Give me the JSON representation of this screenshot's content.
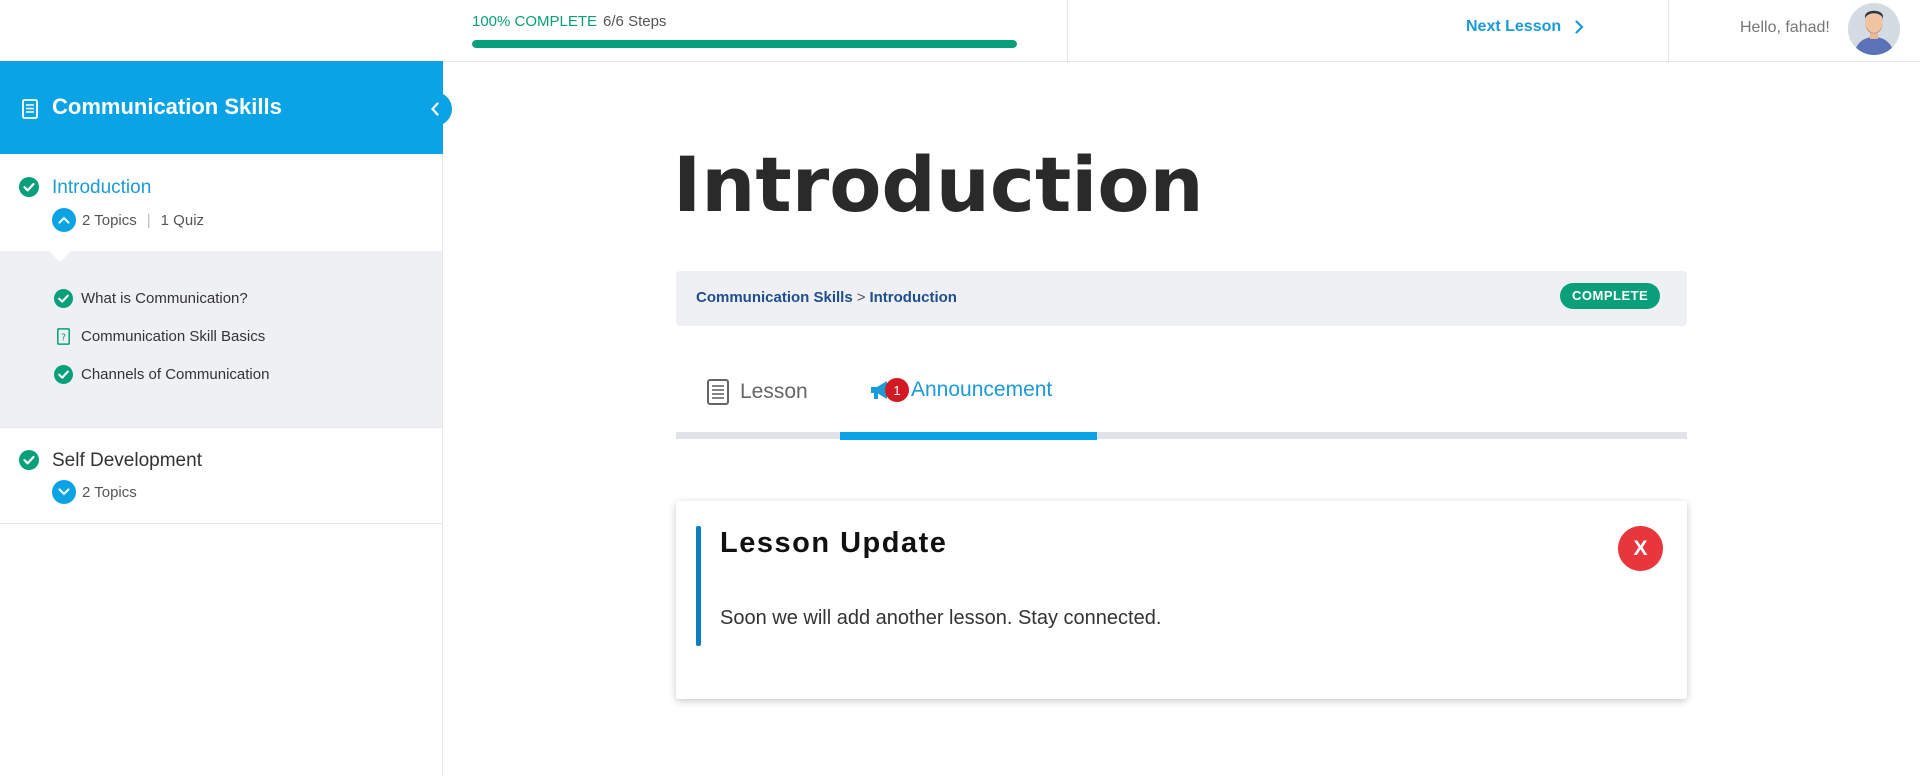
{
  "topbar": {
    "progress_percent_label": "100% COMPLETE",
    "progress_steps": "6/6 Steps",
    "progress_fraction": 1.0,
    "next_lesson_label": "Next Lesson",
    "greeting": "Hello, fahad!"
  },
  "sidebar": {
    "course_title": "Communication Skills",
    "lessons": [
      {
        "title": "Introduction",
        "topics": "2 Topics",
        "quiz": "1 Quiz",
        "expanded": true,
        "items": [
          {
            "label": "What is Communication?",
            "icon": "check-circle-icon"
          },
          {
            "label": "Communication Skill Basics",
            "icon": "quiz-doc-icon"
          },
          {
            "label": "Channels of Communication",
            "icon": "check-circle-icon"
          }
        ]
      },
      {
        "title": "Self Development",
        "topics": "2 Topics",
        "expanded": false
      }
    ]
  },
  "main": {
    "title": "Introduction",
    "breadcrumb": {
      "course": "Communication Skills",
      "separator": ">",
      "lesson": "Introduction"
    },
    "status_badge": "COMPLETE",
    "tabs": [
      {
        "label": "Lesson",
        "icon": "document-icon"
      },
      {
        "label": "Announcement",
        "icon": "megaphone-icon",
        "badge": "1",
        "active": true
      }
    ],
    "announcement": {
      "title": "Lesson Update",
      "body": "Soon we will add another lesson. Stay connected.",
      "close_label": "X"
    }
  },
  "colors": {
    "accent_blue": "#0aa3e6",
    "link_blue": "#1a9bd7",
    "complete_green": "#089f7a",
    "badge_red": "#d21a22",
    "close_red": "#e8363d"
  }
}
